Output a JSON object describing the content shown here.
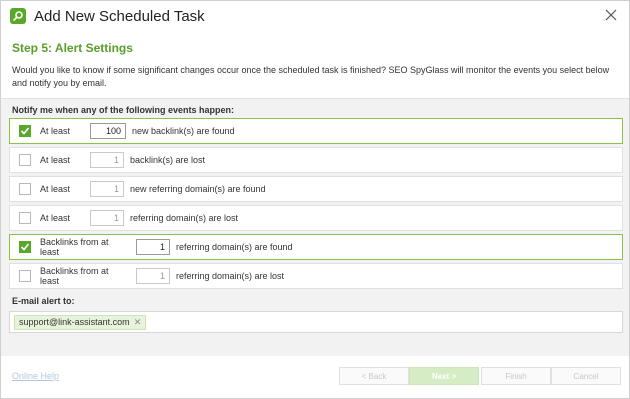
{
  "window": {
    "title": "Add New Scheduled Task"
  },
  "step": {
    "title": "Step 5: Alert Settings",
    "description": "Would you like to know if some significant changes occur once the scheduled task is finished? SEO SpyGlass will monitor the events you select below and notify you by email."
  },
  "events": {
    "header": "Notify me when any of the following events happen:",
    "rows": [
      {
        "checked": true,
        "prefix": "At least",
        "value": "100",
        "suffix": "new backlink(s) are found"
      },
      {
        "checked": false,
        "prefix": "At least",
        "value": "1",
        "suffix": "backlink(s) are lost"
      },
      {
        "checked": false,
        "prefix": "At least",
        "value": "1",
        "suffix": "new referring domain(s) are found"
      },
      {
        "checked": false,
        "prefix": "At least",
        "value": "1",
        "suffix": "referring domain(s) are lost"
      },
      {
        "checked": true,
        "prefix": "Backlinks from at least",
        "value": "1",
        "suffix": "referring domain(s) are found"
      },
      {
        "checked": false,
        "prefix": "Backlinks from at least",
        "value": "1",
        "suffix": "referring domain(s) are lost"
      }
    ]
  },
  "email": {
    "label": "E-mail alert to:",
    "chips": [
      "support@link-assistant.com"
    ]
  },
  "footer": {
    "help": "Online Help",
    "back": "< Back",
    "next": "Next >",
    "finish": "Finish",
    "cancel": "Cancel"
  },
  "colors": {
    "accent": "#5aa82a",
    "panel": "#f2f2f2"
  }
}
